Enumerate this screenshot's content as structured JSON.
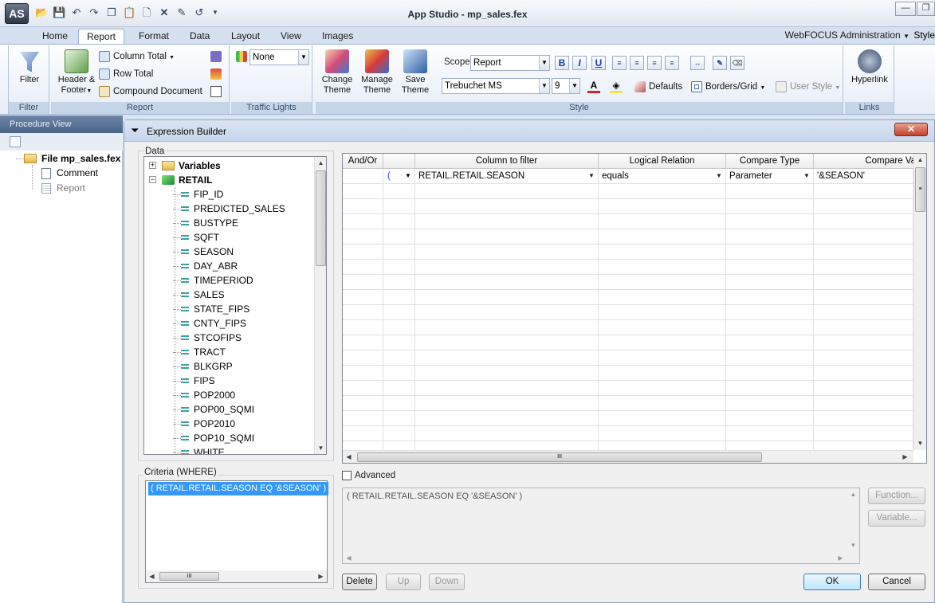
{
  "window": {
    "title": "App Studio - mp_sales.fex",
    "logo": "AS"
  },
  "quick_access": [
    "open-folder-icon",
    "save-icon",
    "undo-icon",
    "redo-icon",
    "copy-icon",
    "paste-icon",
    "new-icon",
    "delete-icon",
    "edit-icon",
    "refresh-icon"
  ],
  "tabs": [
    "Home",
    "Report",
    "Format",
    "Data",
    "Layout",
    "View",
    "Images"
  ],
  "active_tab": "Report",
  "tab_right": {
    "admin": "WebFOCUS Administration",
    "style": "Style"
  },
  "ribbon": {
    "filter": {
      "button": "Filter",
      "group": "Filter"
    },
    "report": {
      "header_footer": "Header &",
      "header_footer2": "Footer",
      "column_total": "Column Total",
      "row_total": "Row Total",
      "compound_document": "Compound Document",
      "group": "Report"
    },
    "traffic": {
      "value": "None",
      "group": "Traffic Lights"
    },
    "theme": {
      "change": "Change",
      "manage": "Manage",
      "save": "Save",
      "theme_word": "Theme"
    },
    "style": {
      "scope_label": "Scope",
      "scope_value": "Report",
      "font": "Trebuchet MS",
      "size": "9",
      "bold": "B",
      "italic": "I",
      "underline": "U",
      "defaults": "Defaults",
      "borders": "Borders/Grid",
      "user_style": "User Style",
      "group": "Style"
    },
    "links": {
      "hyperlink": "Hyperlink",
      "group": "Links"
    }
  },
  "procedure_view": {
    "title": "Procedure View",
    "file": "File mp_sales.fex c",
    "items": [
      "Comment",
      "Report"
    ]
  },
  "dialog": {
    "title": "Expression Builder",
    "data_label": "Data",
    "tree": {
      "variables": "Variables",
      "retail": "RETAIL",
      "fields": [
        "FIP_ID",
        "PREDICTED_SALES",
        "BUSTYPE",
        "SQFT",
        "SEASON",
        "DAY_ABR",
        "TIMEPERIOD",
        "SALES",
        "STATE_FIPS",
        "CNTY_FIPS",
        "STCOFIPS",
        "TRACT",
        "BLKGRP",
        "FIPS",
        "POP2000",
        "POP00_SQMI",
        "POP2010",
        "POP10_SQMI",
        "WHITE"
      ]
    },
    "grid": {
      "headers": [
        "And/Or",
        "",
        "Column to filter",
        "Logical Relation",
        "Compare Type",
        "Compare Valu"
      ],
      "row": {
        "andor": "",
        "paren": "(",
        "column": "RETAIL.RETAIL.SEASON",
        "relation": "equals",
        "compare_type": "Parameter",
        "compare_value": "'&SEASON'"
      }
    },
    "criteria_label": "Criteria (WHERE)",
    "criteria_item": "( RETAIL.RETAIL.SEASON EQ '&SEASON' )",
    "advanced_label": "Advanced",
    "expression_text": "( RETAIL.RETAIL.SEASON EQ '&SEASON' )",
    "buttons": {
      "function": "Function...",
      "variable": "Variable...",
      "delete": "Delete",
      "up": "Up",
      "down": "Down",
      "ok": "OK",
      "cancel": "Cancel"
    }
  }
}
